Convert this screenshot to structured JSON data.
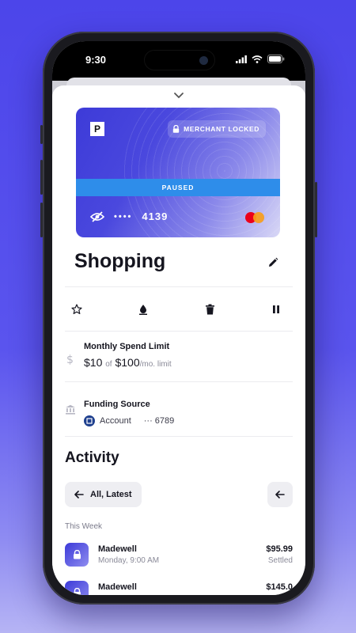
{
  "status_bar": {
    "time": "9:30"
  },
  "card": {
    "logo_letter": "P",
    "merchant_lock_label": "MERCHANT LOCKED",
    "state_label": "PAUSED",
    "masked_dots": "••••",
    "last4": "4139",
    "network": "mastercard"
  },
  "card_title": "Shopping",
  "actions": [
    "star-icon",
    "drop-icon",
    "trash-icon",
    "pause-icon"
  ],
  "spend_limit": {
    "title": "Monthly Spend Limit",
    "spent": "$10",
    "of_text": "of",
    "limit": "$100",
    "period": "/mo. limit"
  },
  "funding": {
    "title": "Funding Source",
    "account_label": "Account",
    "account_mask": "··· 6789"
  },
  "activity": {
    "heading": "Activity",
    "filter_label": "All, Latest",
    "group_label": "This Week",
    "transactions": [
      {
        "merchant": "Madewell",
        "time": "Monday, 9:00 AM",
        "amount": "$95.99",
        "status": "Settled"
      },
      {
        "merchant": "Madewell",
        "time": "",
        "amount": "$145.0",
        "status": ""
      }
    ]
  },
  "colors": {
    "background": "#4c45ea",
    "card_primary": "#3d3bd8",
    "paused_band": "#2e8dea",
    "text_primary": "#15151f"
  }
}
